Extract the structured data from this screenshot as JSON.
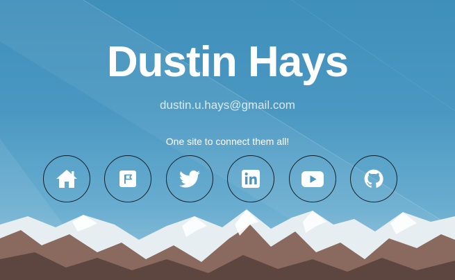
{
  "profile": {
    "name": "Dustin Hays",
    "email": "dustin.u.hays@gmail.com",
    "tagline": "One site to connect them all!"
  },
  "social_links": [
    {
      "icon": "home-icon"
    },
    {
      "icon": "portfolio-flag-icon"
    },
    {
      "icon": "twitter-icon"
    },
    {
      "icon": "linkedin-icon"
    },
    {
      "icon": "youtube-icon"
    },
    {
      "icon": "github-icon"
    }
  ],
  "colors": {
    "background": "#4a98c2",
    "text": "#ffffff",
    "icon_border": "#111d24"
  }
}
